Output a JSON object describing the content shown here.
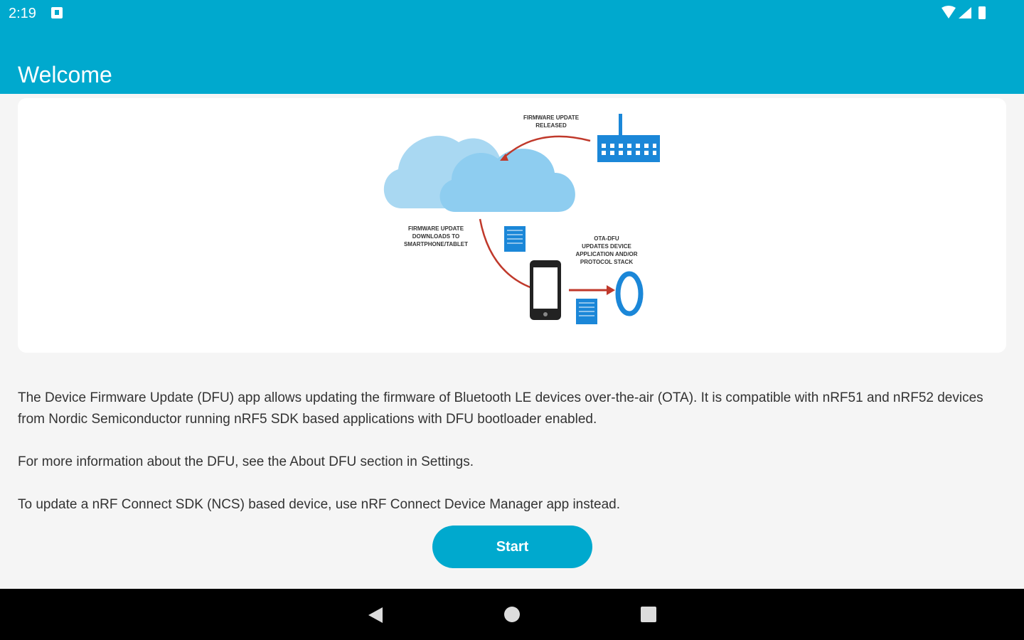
{
  "status_bar": {
    "time": "2:19",
    "icons": [
      "notification-icon",
      "wifi-icon",
      "cell-signal-icon",
      "battery-icon"
    ]
  },
  "app_bar": {
    "title": "Welcome",
    "color": "#00a9ce"
  },
  "illustration": {
    "label_firmware_released": [
      "FIRMWARE UPDATE",
      "RELEASED"
    ],
    "label_download": [
      "FIRMWARE UPDATE",
      "DOWNLOADS TO",
      "SMARTPHONE/TABLET"
    ],
    "label_ota": [
      "OTA-DFU",
      "UPDATES DEVICE",
      "APPLICATION AND/OR",
      "PROTOCOL STACK"
    ]
  },
  "content": {
    "paragraph_1": "The Device Firmware Update (DFU) app allows updating the firmware of Bluetooth LE devices over-the-air (OTA). It is compatible with nRF51 and nRF52 devices from Nordic Semiconductor running nRF5 SDK based applications with DFU bootloader enabled.",
    "paragraph_2": "For more information about the DFU, see the About DFU section in Settings.",
    "paragraph_3": "To update a nRF Connect SDK (NCS) based device, use nRF Connect Device Manager app instead."
  },
  "actions": {
    "start_label": "Start"
  },
  "nav_bar": {
    "icons": [
      "back-icon",
      "home-icon",
      "recents-icon"
    ]
  }
}
